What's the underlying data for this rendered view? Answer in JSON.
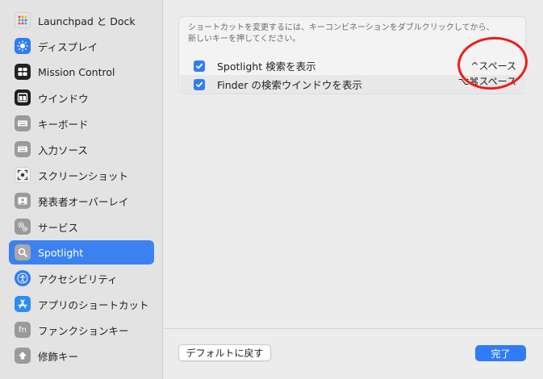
{
  "sidebar": {
    "items": [
      {
        "label": "Launchpad と Dock",
        "icon": "launchpad-icon"
      },
      {
        "label": "ディスプレイ",
        "icon": "display-icon"
      },
      {
        "label": "Mission Control",
        "icon": "mission-control-icon"
      },
      {
        "label": "ウインドウ",
        "icon": "window-icon"
      },
      {
        "label": "キーボード",
        "icon": "keyboard-icon"
      },
      {
        "label": "入力ソース",
        "icon": "input-sources-icon"
      },
      {
        "label": "スクリーンショット",
        "icon": "screenshot-icon"
      },
      {
        "label": "発表者オーバーレイ",
        "icon": "presenter-overlay-icon"
      },
      {
        "label": "サービス",
        "icon": "services-icon"
      },
      {
        "label": "Spotlight",
        "icon": "spotlight-icon",
        "selected": true
      },
      {
        "label": "アクセシビリティ",
        "icon": "accessibility-icon"
      },
      {
        "label": "アプリのショートカット",
        "icon": "app-shortcuts-icon"
      },
      {
        "label": "ファンクションキー",
        "icon": "function-keys-icon"
      },
      {
        "label": "修飾キー",
        "icon": "modifier-keys-icon"
      }
    ],
    "icon_text": {
      "function_keys": "fn"
    }
  },
  "main": {
    "description_line1": "ショートカットを変更するには、キーコンビネーションをダブルクリックしてから、",
    "description_line2": "新しいキーを押してください。",
    "shortcuts": [
      {
        "label": "Spotlight 検索を表示",
        "keys": "^スペース",
        "checked": true
      },
      {
        "label": "Finder の検索ウインドウを表示",
        "keys": "⌥⌘スペース",
        "checked": true
      }
    ]
  },
  "footer": {
    "restore_defaults_label": "デフォルトに戻す",
    "done_label": "完了"
  },
  "colors": {
    "accent": "#2f7cf6",
    "selection": "#3b82f0",
    "annotation": "#ee1c1c"
  }
}
